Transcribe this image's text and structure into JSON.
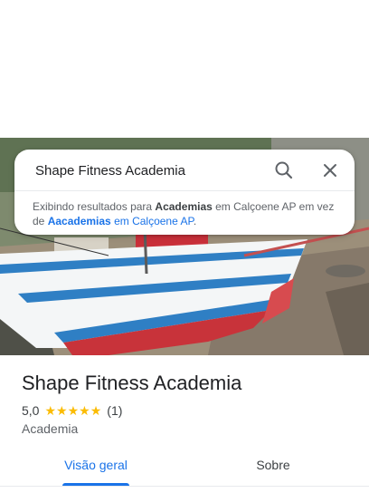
{
  "search": {
    "query": "Shape Fitness Academia",
    "search_icon": "search-icon",
    "close_icon": "close-icon"
  },
  "notice": {
    "prefix": "Exibindo resultados para ",
    "corrected_term": "Academias",
    "corrected_location": " em Calçoene AP",
    "middle": " em vez de ",
    "original_term": "Aacademias",
    "original_location": " em Calçoene AP",
    "suffix": "."
  },
  "place": {
    "name": "Shape Fitness Academia",
    "rating": "5,0",
    "stars": [
      "★",
      "★",
      "★",
      "★",
      "★"
    ],
    "review_count": "(1)",
    "category": "Academia"
  },
  "tabs": [
    {
      "label": "Visão geral",
      "active": true
    },
    {
      "label": "Sobre",
      "active": false
    }
  ],
  "colors": {
    "accent": "#1a73e8",
    "star": "#fbbc04",
    "boat_hull": "#f4f6f7",
    "boat_stripe": "#2f7fc4",
    "boat_keel": "#c8333a"
  }
}
